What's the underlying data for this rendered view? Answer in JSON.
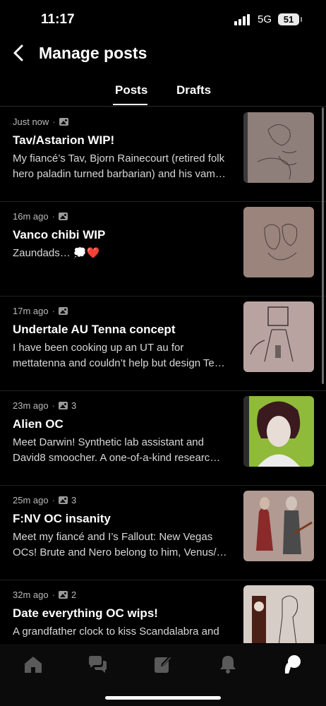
{
  "status_bar": {
    "time": "11:17",
    "network": "5G",
    "battery": "51"
  },
  "header": {
    "title": "Manage posts"
  },
  "tabs": [
    {
      "label": "Posts"
    },
    {
      "label": "Drafts"
    }
  ],
  "posts": [
    {
      "time": "Just now",
      "image_count": "",
      "title": "Tav/Astarion WIP!",
      "body_line1": "My fiancé’s Tav, Bjorn Rainecourt (retired folk",
      "body_line2": "hero paladin turned barbarian) and his vam…"
    },
    {
      "time": "16m ago",
      "image_count": "",
      "title": "Vanco chibi WIP",
      "body_line1": "Zaundads… 💭❤️",
      "body_line2": ""
    },
    {
      "time": "17m ago",
      "image_count": "",
      "title": "Undertale AU Tenna concept",
      "body_line1": "I have been cooking up an UT au for",
      "body_line2": "mettatenna and couldn’t help but design Te…"
    },
    {
      "time": "23m ago",
      "image_count": "3",
      "title": "Alien OC",
      "body_line1": "Meet Darwin! Synthetic lab assistant and",
      "body_line2": "David8 smoocher.  A one-of-a-kind researc…"
    },
    {
      "time": "25m ago",
      "image_count": "3",
      "title": "F:NV OC insanity",
      "body_line1": "Meet my fiancé and I’s Fallout: New Vegas",
      "body_line2": "OCs! Brute and Nero belong to him, Venus/…"
    },
    {
      "time": "32m ago",
      "image_count": "2",
      "title": "Date everything OC wips!",
      "body_line1": "A grandfather clock to kiss Scandalabra and",
      "body_line2": ""
    }
  ],
  "tab_bar": [
    "home-icon",
    "chat-icon",
    "edit-icon",
    "bell-icon",
    "patreon-icon"
  ]
}
